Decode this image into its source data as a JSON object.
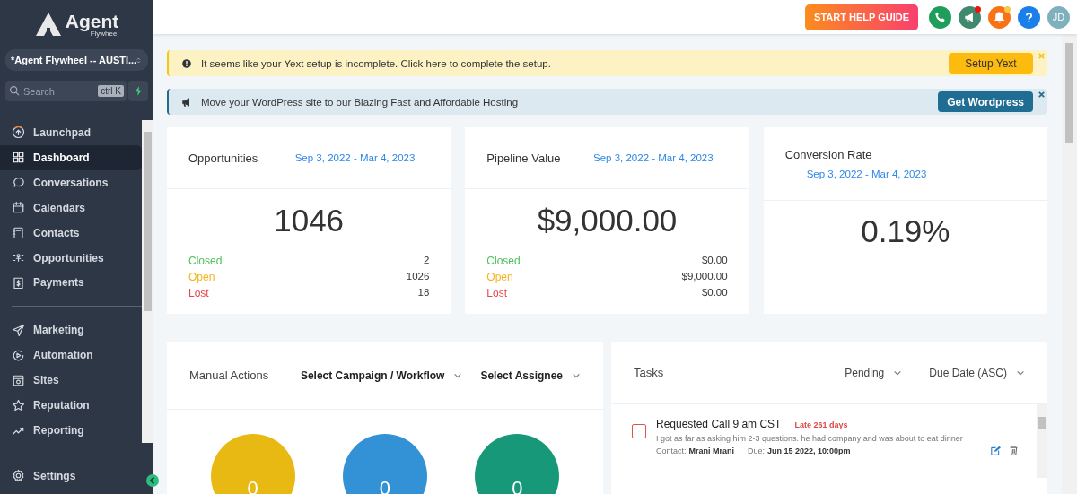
{
  "sidebar": {
    "logo": {
      "title": "Agent",
      "subtitle": "Flywheel"
    },
    "account": "*Agent Flywheel -- AUSTI...",
    "search": {
      "placeholder": "Search",
      "shortcut": "ctrl K"
    },
    "items": [
      {
        "label": "Launchpad",
        "selected": false
      },
      {
        "label": "Dashboard",
        "selected": true
      },
      {
        "label": "Conversations",
        "selected": false
      },
      {
        "label": "Calendars",
        "selected": false
      },
      {
        "label": "Contacts",
        "selected": false
      },
      {
        "label": "Opportunities",
        "selected": false
      },
      {
        "label": "Payments",
        "selected": false
      },
      {
        "label": "Marketing",
        "selected": false
      },
      {
        "label": "Automation",
        "selected": false
      },
      {
        "label": "Sites",
        "selected": false
      },
      {
        "label": "Reputation",
        "selected": false
      },
      {
        "label": "Reporting",
        "selected": false
      }
    ],
    "settings": "Settings"
  },
  "header": {
    "help_button": "START HELP GUIDE",
    "icons": [
      {
        "kind": "phone",
        "color": "#1e9e5a",
        "badge": false
      },
      {
        "kind": "megaphone",
        "color": "#3f8a6e",
        "badge": true
      },
      {
        "kind": "bell",
        "color": "#f97316",
        "badge": true
      },
      {
        "kind": "help",
        "color": "#1a7fe8",
        "badge": false
      }
    ],
    "avatar": "JD"
  },
  "banners": [
    {
      "kind": "warning",
      "text": "It seems like your Yext setup is incomplete. Click here to complete the setup.",
      "button": "Setup Yext"
    },
    {
      "kind": "info",
      "text": "Move your WordPress site to our Blazing Fast and Affordable Hosting",
      "button": "Get Wordpress"
    }
  ],
  "stat_cards": [
    {
      "title": "Opportunities",
      "date_range": "Sep 3, 2022 - Mar 4, 2023",
      "value": "1046",
      "breakdown": [
        {
          "label": "Closed",
          "value": "2",
          "color": "#4cc05a"
        },
        {
          "label": "Open",
          "value": "1026",
          "color": "#f5b41f"
        },
        {
          "label": "Lost",
          "value": "18",
          "color": "#e5484d"
        }
      ]
    },
    {
      "title": "Pipeline Value",
      "date_range": "Sep 3, 2022 - Mar 4, 2023",
      "value": "$9,000.00",
      "breakdown": [
        {
          "label": "Closed",
          "value": "$0.00",
          "color": "#4cc05a"
        },
        {
          "label": "Open",
          "value": "$9,000.00",
          "color": "#f5b41f"
        },
        {
          "label": "Lost",
          "value": "$0.00",
          "color": "#e5484d"
        }
      ]
    },
    {
      "title": "Conversion Rate",
      "date_range": "Sep 3, 2022 - Mar 4, 2023",
      "value": "0.19%"
    }
  ],
  "manual_actions": {
    "title": "Manual Actions",
    "filters": [
      "Select Campaign / Workflow",
      "Select Assignee"
    ],
    "counts": [
      {
        "value": "0",
        "color": "#e9b913"
      },
      {
        "value": "0",
        "color": "#3391d5"
      },
      {
        "value": "0",
        "color": "#179878"
      }
    ]
  },
  "tasks": {
    "title": "Tasks",
    "filters": [
      "Pending",
      "Due Date (ASC)"
    ],
    "items": [
      {
        "title": "Requested Call 9 am CST",
        "late": "Late 261 days",
        "note": "I got as far as asking him 2-3 questions. he had company and was about to eat dinner",
        "contact_label": "Contact:",
        "contact": "Mrani Mrani",
        "due_label": "Due:",
        "due": "Jun 15 2022, 10:00pm",
        "checked": false
      }
    ]
  }
}
